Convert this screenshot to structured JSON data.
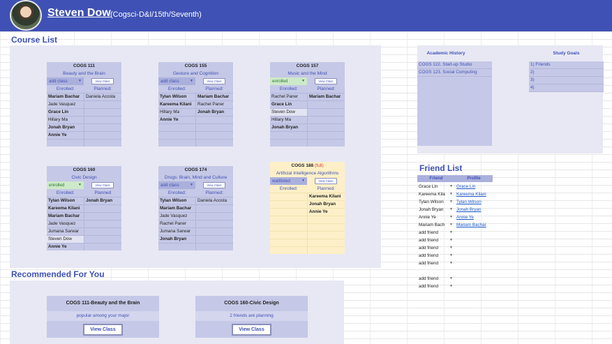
{
  "header": {
    "user_name": "Steven Dow",
    "user_sub": "(Cogsci-D&I/15th/Seventh)"
  },
  "sections": {
    "course_list": "Course List",
    "recommended": "Recommended For You",
    "friend_list": "Friend List"
  },
  "courses": [
    {
      "code": "COGS 111",
      "full": "",
      "desc": "Beauty and the Brain",
      "status": "add class",
      "status_color": "#aab0dc",
      "view_label": "View Class",
      "enrolled_label": "Enrolled:",
      "planned_label": "Planned:",
      "rows": [
        [
          "Mariam Bachar",
          "Daniela Acosta"
        ],
        [
          "Jade Vasquez",
          ""
        ],
        [
          "Grace Lin",
          ""
        ],
        [
          "Hillary Ma",
          ""
        ],
        [
          "Jonah Bryan",
          ""
        ],
        [
          "Annie Ye",
          ""
        ]
      ]
    },
    {
      "code": "COGS 155",
      "full": "",
      "desc": "Gesture and Cognition",
      "status": "add class",
      "status_color": "#aab0dc",
      "view_label": "View Class",
      "enrolled_label": "Enrolled:",
      "planned_label": "Planned:",
      "rows": [
        [
          "Tylan Wilson",
          "Mariam Bachar"
        ],
        [
          "Kareema Kilani",
          "Rachel Paner"
        ],
        [
          "Hillary Ma",
          "Jonah Bryan"
        ],
        [
          "Annie Ye",
          ""
        ]
      ]
    },
    {
      "code": "COGS 157",
      "full": "",
      "desc": "Music and the Mind",
      "status": "enrolled",
      "status_color": "#cde9c9",
      "view_label": "View Class",
      "enrolled_label": "Enrolled:",
      "planned_label": "Planned:",
      "rows": [
        [
          "Rachel Paner",
          "Mariam Bachar"
        ],
        [
          "Grace Lin",
          ""
        ],
        [
          "Steven Dow",
          ""
        ],
        [
          "Hillary Ma",
          ""
        ],
        [
          "Jonah Bryan",
          ""
        ]
      ]
    },
    {
      "code": "COGS 160",
      "full": "",
      "desc": "Civic Design",
      "status": "enrolled",
      "status_color": "#cde9c9",
      "view_label": "View Class",
      "enrolled_label": "Enrolled:",
      "planned_label": "Planned",
      "rows": [
        [
          "Tylan Wilson",
          "Jonah Bryan"
        ],
        [
          "Kareema Kilani",
          ""
        ],
        [
          "Mariam Bachar",
          ""
        ],
        [
          "Jade Vasquez",
          ""
        ],
        [
          "Jumana Sarwar",
          ""
        ],
        [
          "Steven Dow",
          ""
        ],
        [
          "Annie Ye",
          ""
        ]
      ]
    },
    {
      "code": "COGS 174",
      "full": "",
      "desc": "Drugs: Brain, Mind and Culture",
      "status": "add class",
      "status_color": "#aab0dc",
      "view_label": "View Class",
      "enrolled_label": "Enrolled:",
      "planned_label": "Planned:",
      "rows": [
        [
          "Tylan Wilson",
          "Daniela Acosta"
        ],
        [
          "Mariam Bachar",
          ""
        ],
        [
          "Jade Vasquez",
          ""
        ],
        [
          "Rachel Paner",
          ""
        ],
        [
          "Jumana Sarwar",
          ""
        ],
        [
          "Jonah Bryan",
          ""
        ]
      ]
    },
    {
      "code": "COGS 188",
      "full": "(full)",
      "desc": "Artificial Intelligence Algorithms",
      "status": "waitlisted",
      "status_color": "#aab0dc",
      "view_label": "View Class",
      "enrolled_label": "Enrolled:",
      "planned_label": "Planned:",
      "rows": [
        [
          "",
          "Kareema Kilani"
        ],
        [
          "",
          "Jonah Bryan"
        ],
        [
          "",
          "Annie Ye"
        ]
      ]
    }
  ],
  "recommended": [
    {
      "title": "COGS 111-Beauty and the Brain",
      "subtitle": "popular among your major",
      "button": "View Class"
    },
    {
      "title": "COGS 160-Civic Design",
      "subtitle": "2 friends are planning",
      "button": "View Class"
    }
  ],
  "academic_history": {
    "title": "Academic History",
    "items": [
      "COGS 122. Start-up Studio",
      "COGS 123. Social Computing"
    ]
  },
  "study_goals": {
    "title": "Study Goals",
    "items": [
      "1) Friends",
      "2)",
      "3)",
      "4)"
    ]
  },
  "friend_list": {
    "col_friend": "Friend",
    "col_profile": "Profile",
    "rows": [
      {
        "name": "Grace Lin",
        "profile": "Grace Lin"
      },
      {
        "name": "Kareema Kila",
        "profile": "Kareema Kilani"
      },
      {
        "name": "Tylan Wilson",
        "profile": "Tylan Wilson"
      },
      {
        "name": "Jonah Bryan",
        "profile": "Jonah Bryan"
      },
      {
        "name": "Annie Ye",
        "profile": "Annie Ye"
      },
      {
        "name": "Mariam Bach",
        "profile": "Mariam Bachar"
      },
      {
        "name": "add friend",
        "profile": ""
      },
      {
        "name": "add friend",
        "profile": ""
      },
      {
        "name": "add friend",
        "profile": ""
      },
      {
        "name": "add friend",
        "profile": ""
      },
      {
        "name": "add friend",
        "profile": ""
      },
      {
        "name": "",
        "profile": ""
      },
      {
        "name": "add friend",
        "profile": ""
      },
      {
        "name": "add friend",
        "profile": ""
      }
    ]
  }
}
